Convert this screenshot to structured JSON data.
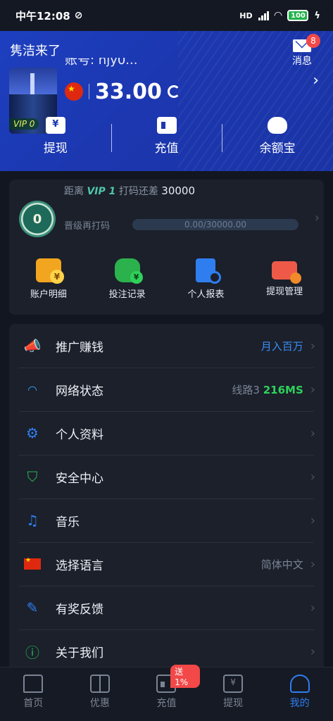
{
  "status_bar": {
    "time": "中午12:08",
    "battery": "100",
    "network": "HD"
  },
  "header": {
    "username": "隽洁来了",
    "account_id": "账号: hjy0...",
    "messages": {
      "label": "消息",
      "badge": "8"
    },
    "balance": "33.00",
    "actions": [
      {
        "label": "提现",
        "icon": "withdraw-ticket-icon"
      },
      {
        "label": "充值",
        "icon": "wallet-icon"
      },
      {
        "label": "余额宝",
        "icon": "piggy-bank-icon"
      }
    ],
    "avatar_vip": "VIP 0"
  },
  "vip": {
    "coin_level": "0",
    "prefix": "距离",
    "next_level": "VIP 1",
    "middle": "打码还差",
    "remaining": "30000",
    "sub_label": "晋级再打码",
    "progress_text": "0.00/30000.00",
    "progress_fraction": 0.0
  },
  "quick_actions": [
    {
      "label": "账户明细",
      "icon": "coins-icon"
    },
    {
      "label": "投注记录",
      "icon": "gamepad-icon"
    },
    {
      "label": "个人报表",
      "icon": "report-icon"
    },
    {
      "label": "提现管理",
      "icon": "card-settings-icon"
    }
  ],
  "menu": [
    {
      "label": "推广赚钱",
      "right": "月入百万",
      "icon": "megaphone-icon"
    },
    {
      "label": "网络状态",
      "right_prefix": "线路3",
      "right_value": "216MS",
      "icon": "wifi-icon"
    },
    {
      "label": "个人资料",
      "right": "",
      "icon": "gear-icon"
    },
    {
      "label": "安全中心",
      "right": "",
      "icon": "shield-icon"
    },
    {
      "label": "音乐",
      "right": "",
      "icon": "music-icon"
    },
    {
      "label": "选择语言",
      "right": "简体中文",
      "icon": "china-flag-icon"
    },
    {
      "label": "有奖反馈",
      "right": "",
      "icon": "edit-icon"
    },
    {
      "label": "关于我们",
      "right": "",
      "icon": "info-icon"
    }
  ],
  "tabbar": [
    {
      "label": "首页",
      "icon": "home-icon"
    },
    {
      "label": "优惠",
      "icon": "gift-icon"
    },
    {
      "label": "充值",
      "icon": "wallet-icon",
      "promo": "送1%"
    },
    {
      "label": "提现",
      "icon": "withdraw-icon"
    },
    {
      "label": "我的",
      "icon": "user-icon",
      "active": true
    }
  ],
  "colors": {
    "header_blue": "#1c37b0",
    "accent_blue": "#2f7ef0",
    "ping_green": "#2fd15a",
    "badge_red": "#f24848"
  }
}
